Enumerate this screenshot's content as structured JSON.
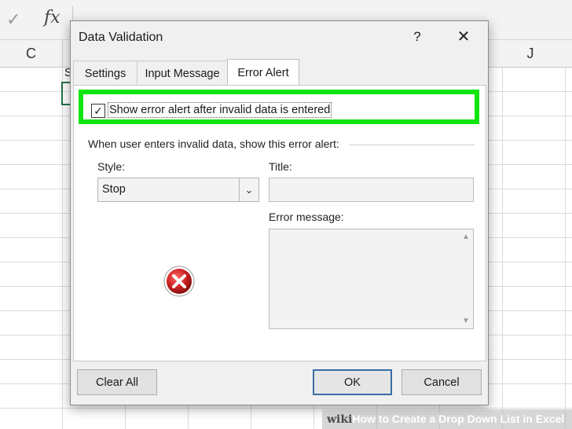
{
  "excel": {
    "formula_bar": {
      "check_icon": "checkmark-icon",
      "fx_label": "fx"
    },
    "columns": [
      "C",
      "J"
    ],
    "cell_fragment": "S"
  },
  "dialog": {
    "title": "Data Validation",
    "help_label": "?",
    "close_label": "✕",
    "tabs": [
      {
        "label": "Settings",
        "active": false
      },
      {
        "label": "Input Message",
        "active": false
      },
      {
        "label": "Error Alert",
        "active": true
      }
    ],
    "show_alert_checkbox": {
      "checked": true,
      "label": "Show error alert after invalid data is entered"
    },
    "group_label": "When user enters invalid data, show this error alert:",
    "style": {
      "label": "Style:",
      "value": "Stop"
    },
    "title_field": {
      "label": "Title:",
      "value": ""
    },
    "error_message_field": {
      "label": "Error message:",
      "value": ""
    },
    "stop_icon": "error-stop-icon",
    "buttons": {
      "clear_all": "Clear All",
      "ok": "OK",
      "cancel": "Cancel"
    }
  },
  "watermark": {
    "brand": "wiki",
    "text": "How to Create a Drop Down List in Excel"
  },
  "colors": {
    "highlight": "#10e510",
    "stop_icon": "#cc2222",
    "excel_green": "#217346"
  }
}
